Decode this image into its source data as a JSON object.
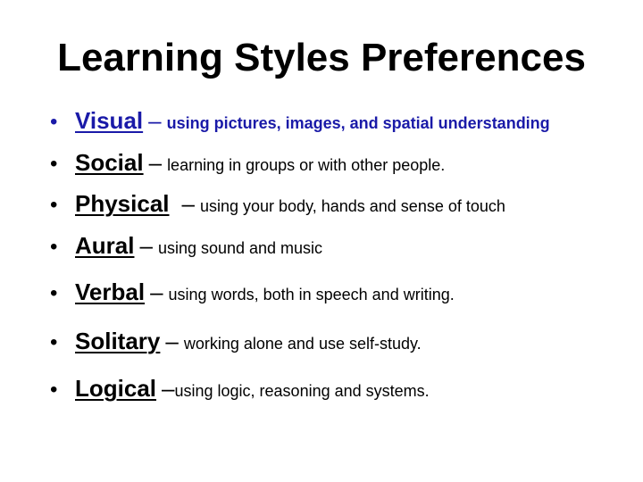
{
  "slide": {
    "title": "Learning Styles Preferences",
    "items": [
      {
        "term": "Visual",
        "dash": "–",
        "description": "using pictures, images, and spatial understanding",
        "color": "#1a1aa8"
      },
      {
        "term": "Social",
        "dash": "–",
        "description": "learning in groups or with other people."
      },
      {
        "term": "Physical",
        "dash": " –",
        "description": "using your body, hands and sense of touch"
      },
      {
        "term": "Aural ",
        "dash": "–",
        "description": "using sound and music"
      },
      {
        "term": "Verbal ",
        "dash": "–",
        "description": "using words, both in speech and writing."
      },
      {
        "term": "Solitary ",
        "dash": "–",
        "description": "working alone and use self-study."
      },
      {
        "term": "Logical ",
        "dash": "–",
        "description": "using logic, reasoning and systems."
      }
    ],
    "bullet": "•"
  }
}
